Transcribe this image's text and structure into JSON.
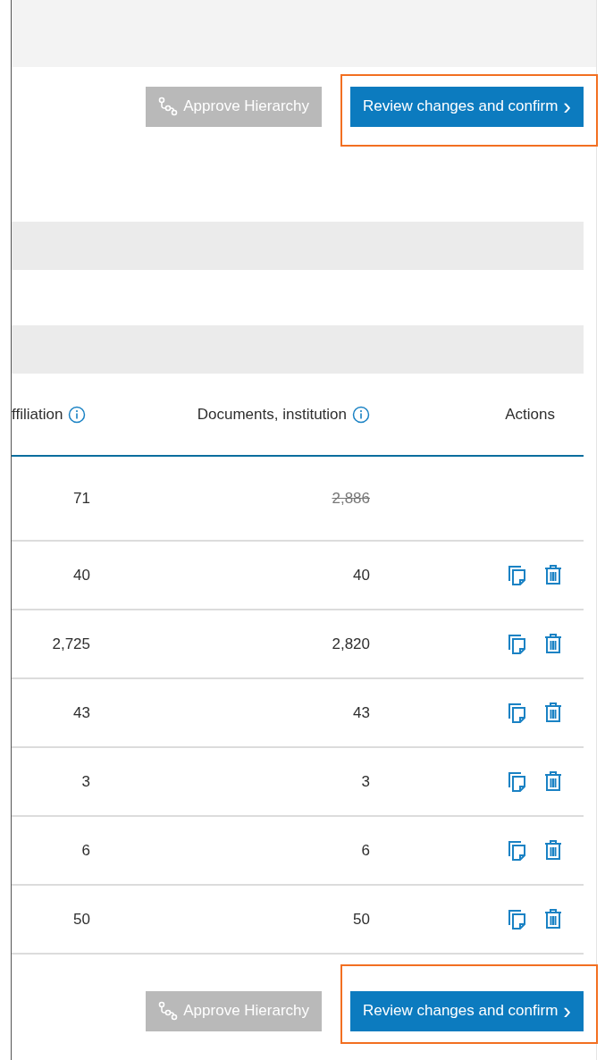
{
  "toolbar_top": {
    "approve_button": {
      "label": "Approve Hierarchy",
      "disabled": true,
      "highlighted": false
    },
    "review_button": {
      "label": "Review changes and confirm",
      "chevron": "›",
      "disabled": false,
      "highlighted": true
    }
  },
  "table": {
    "columns": [
      {
        "label": "ffiliation",
        "info": true
      },
      {
        "label": "Documents, institution",
        "info": true
      },
      {
        "label": "Actions",
        "info": false
      }
    ],
    "rows": [
      {
        "affiliation": "71",
        "institution": "2,886",
        "struck": true,
        "actions": false
      },
      {
        "affiliation": "40",
        "institution": "40",
        "struck": false,
        "actions": true
      },
      {
        "affiliation": "2,725",
        "institution": "2,820",
        "struck": false,
        "actions": true
      },
      {
        "affiliation": "43",
        "institution": "43",
        "struck": false,
        "actions": true
      },
      {
        "affiliation": "3",
        "institution": "3",
        "struck": false,
        "actions": true
      },
      {
        "affiliation": "6",
        "institution": "6",
        "struck": false,
        "actions": true
      },
      {
        "affiliation": "50",
        "institution": "50",
        "struck": false,
        "actions": true
      }
    ]
  },
  "toolbar_bottom": {
    "approve_button": {
      "label": "Approve Hierarchy",
      "disabled": true,
      "highlighted": false
    },
    "review_button": {
      "label": "Review changes and confirm",
      "chevron": "›",
      "disabled": false,
      "highlighted": true
    }
  }
}
